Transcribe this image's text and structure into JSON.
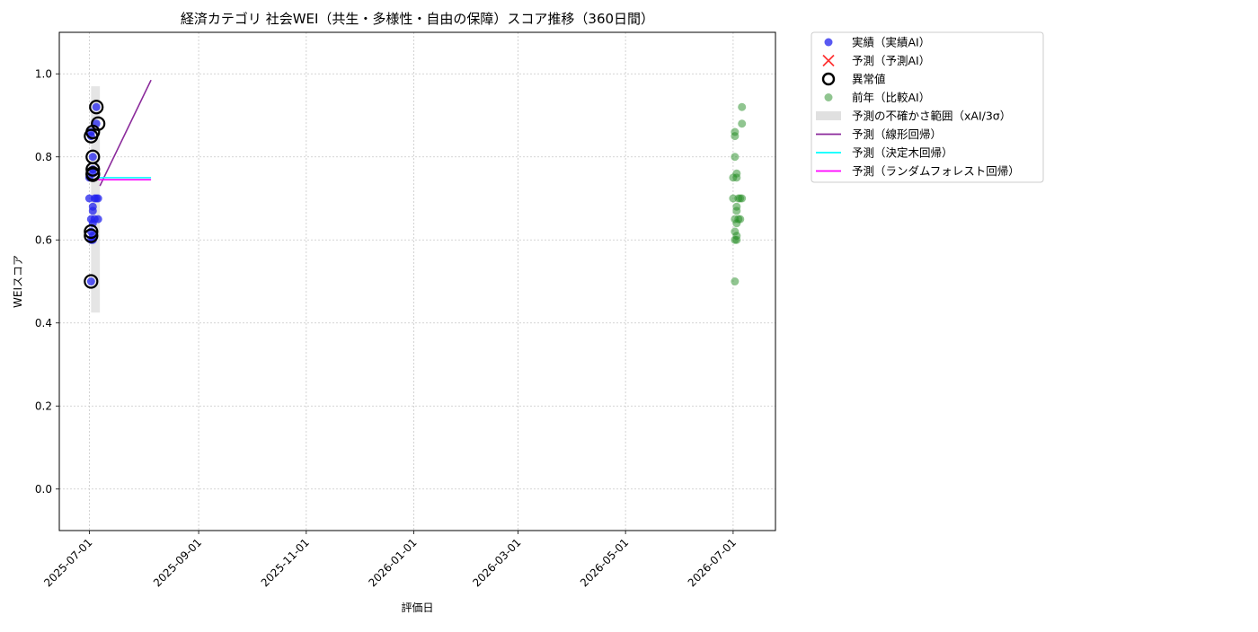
{
  "chart_data": {
    "type": "scatter",
    "title": "経済カテゴリ 社会WEI（共生・多様性・自由の保障）スコア推移（360日間）",
    "xlabel": "評価日",
    "ylabel": "WEIスコア",
    "x_ticks": [
      "2025-07-01",
      "2025-09-01",
      "2025-11-01",
      "2026-01-01",
      "2026-03-01",
      "2026-05-01",
      "2026-07-01"
    ],
    "y_ticks": [
      0.0,
      0.2,
      0.4,
      0.6,
      0.8,
      1.0
    ],
    "xlim": [
      "2025-06-14",
      "2026-07-25"
    ],
    "ylim": [
      -0.1,
      1.1
    ],
    "grid": true,
    "legend_position": "outside-right-top",
    "legend": [
      {
        "key": "actual",
        "label": "実績（実績AI）"
      },
      {
        "key": "predicted",
        "label": "予測（予測AI）"
      },
      {
        "key": "anomaly",
        "label": "異常値"
      },
      {
        "key": "previous_year",
        "label": "前年（比較AI）"
      },
      {
        "key": "uncertainty",
        "label": "予測の不確かさ範囲（xAI/3σ）"
      },
      {
        "key": "linear",
        "label": "予測（線形回帰）"
      },
      {
        "key": "tree",
        "label": "予測（決定木回帰）"
      },
      {
        "key": "forest",
        "label": "予測（ランダムフォレスト回帰）"
      }
    ],
    "colors": {
      "actual": "#2222ee",
      "predicted": "#ff3333",
      "anomaly": "#000000",
      "previous_year": "#228b22",
      "uncertainty": "#d3d3d3",
      "linear": "#8b2a9b",
      "tree": "#00ffff",
      "forest": "#ff00ff"
    },
    "series": [
      {
        "key": "actual",
        "kind": "scatter",
        "points": [
          [
            "2025-07-01",
            0.7
          ],
          [
            "2025-07-01",
            0.75
          ],
          [
            "2025-07-02",
            0.85
          ],
          [
            "2025-07-02",
            0.86
          ],
          [
            "2025-07-02",
            0.6
          ],
          [
            "2025-07-02",
            0.62
          ],
          [
            "2025-07-02",
            0.5
          ],
          [
            "2025-07-02",
            0.65
          ],
          [
            "2025-07-03",
            0.68
          ],
          [
            "2025-07-03",
            0.67
          ],
          [
            "2025-07-03",
            0.8
          ],
          [
            "2025-07-03",
            0.76
          ],
          [
            "2025-07-03",
            0.77
          ],
          [
            "2025-07-03",
            0.61
          ],
          [
            "2025-07-03",
            0.64
          ],
          [
            "2025-07-03",
            0.6
          ],
          [
            "2025-07-04",
            0.7
          ],
          [
            "2025-07-04",
            0.65
          ],
          [
            "2025-07-05",
            0.92
          ],
          [
            "2025-07-05",
            0.88
          ],
          [
            "2025-07-05",
            0.7
          ],
          [
            "2025-07-06",
            0.7
          ],
          [
            "2025-07-06",
            0.65
          ]
        ]
      },
      {
        "key": "anomaly",
        "kind": "scatter",
        "points": [
          [
            "2025-07-02",
            0.5
          ],
          [
            "2025-07-02",
            0.61
          ],
          [
            "2025-07-02",
            0.62
          ],
          [
            "2025-07-02",
            0.85
          ],
          [
            "2025-07-03",
            0.86
          ],
          [
            "2025-07-03",
            0.8
          ],
          [
            "2025-07-03",
            0.76
          ],
          [
            "2025-07-03",
            0.77
          ],
          [
            "2025-07-03",
            0.757
          ],
          [
            "2025-07-05",
            0.92
          ],
          [
            "2025-07-06",
            0.88
          ]
        ]
      },
      {
        "key": "previous_year",
        "kind": "scatter",
        "points": [
          [
            "2026-07-01",
            0.7
          ],
          [
            "2026-07-01",
            0.75
          ],
          [
            "2026-07-02",
            0.85
          ],
          [
            "2026-07-02",
            0.86
          ],
          [
            "2026-07-02",
            0.6
          ],
          [
            "2026-07-02",
            0.62
          ],
          [
            "2026-07-02",
            0.5
          ],
          [
            "2026-07-02",
            0.65
          ],
          [
            "2026-07-03",
            0.68
          ],
          [
            "2026-07-03",
            0.67
          ],
          [
            "2026-07-02",
            0.8
          ],
          [
            "2026-07-03",
            0.76
          ],
          [
            "2026-07-03",
            0.75
          ],
          [
            "2026-07-03",
            0.61
          ],
          [
            "2026-07-03",
            0.64
          ],
          [
            "2026-07-03",
            0.6
          ],
          [
            "2026-07-04",
            0.7
          ],
          [
            "2026-07-04",
            0.65
          ],
          [
            "2026-07-06",
            0.92
          ],
          [
            "2026-07-06",
            0.88
          ],
          [
            "2026-07-05",
            0.7
          ],
          [
            "2026-07-06",
            0.7
          ],
          [
            "2026-07-05",
            0.65
          ]
        ]
      },
      {
        "key": "uncertainty",
        "kind": "band",
        "x": [
          "2025-07-02",
          "2025-07-07"
        ],
        "y": [
          0.425,
          0.97
        ]
      },
      {
        "key": "linear",
        "kind": "line",
        "points": [
          [
            "2025-07-07",
            0.73
          ],
          [
            "2025-08-05",
            0.985
          ]
        ]
      },
      {
        "key": "tree",
        "kind": "line",
        "points": [
          [
            "2025-07-06",
            0.75
          ],
          [
            "2025-08-05",
            0.75
          ]
        ]
      },
      {
        "key": "forest",
        "kind": "line",
        "points": [
          [
            "2025-07-06",
            0.745
          ],
          [
            "2025-08-05",
            0.745
          ]
        ]
      }
    ]
  }
}
